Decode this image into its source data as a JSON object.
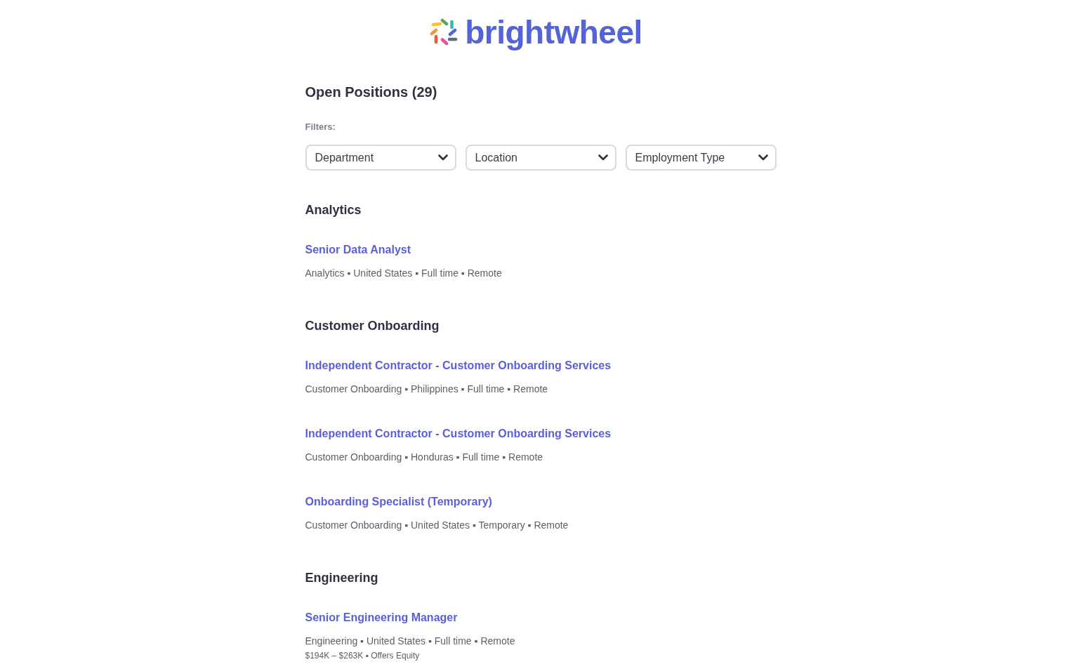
{
  "header": {
    "brand": "brightwheel"
  },
  "title": "Open Positions (29)",
  "filters": {
    "label": "Filters:",
    "dropdowns": [
      {
        "label": "Department"
      },
      {
        "label": "Location"
      },
      {
        "label": "Employment Type"
      }
    ]
  },
  "departments": [
    {
      "name": "Analytics",
      "jobs": [
        {
          "title": "Senior Data Analyst",
          "meta": "Analytics ▪ United States ▪ Full time ▪ Remote"
        }
      ]
    },
    {
      "name": "Customer Onboarding",
      "jobs": [
        {
          "title": "Independent Contractor - Customer Onboarding Services",
          "meta": "Customer Onboarding ▪ Philippines ▪ Full time ▪ Remote"
        },
        {
          "title": "Independent Contractor - Customer Onboarding Services",
          "meta": "Customer Onboarding ▪ Honduras ▪ Full time ▪ Remote"
        },
        {
          "title": "Onboarding Specialist (Temporary)",
          "meta": "Customer Onboarding ▪ United States ▪ Temporary ▪ Remote"
        }
      ]
    },
    {
      "name": "Engineering",
      "jobs": [
        {
          "title": "Senior Engineering Manager",
          "meta": "Engineering ▪ United States ▪ Full time ▪ Remote",
          "compensation": "$194K – $263K ▪ Offers Equity"
        }
      ]
    }
  ]
}
